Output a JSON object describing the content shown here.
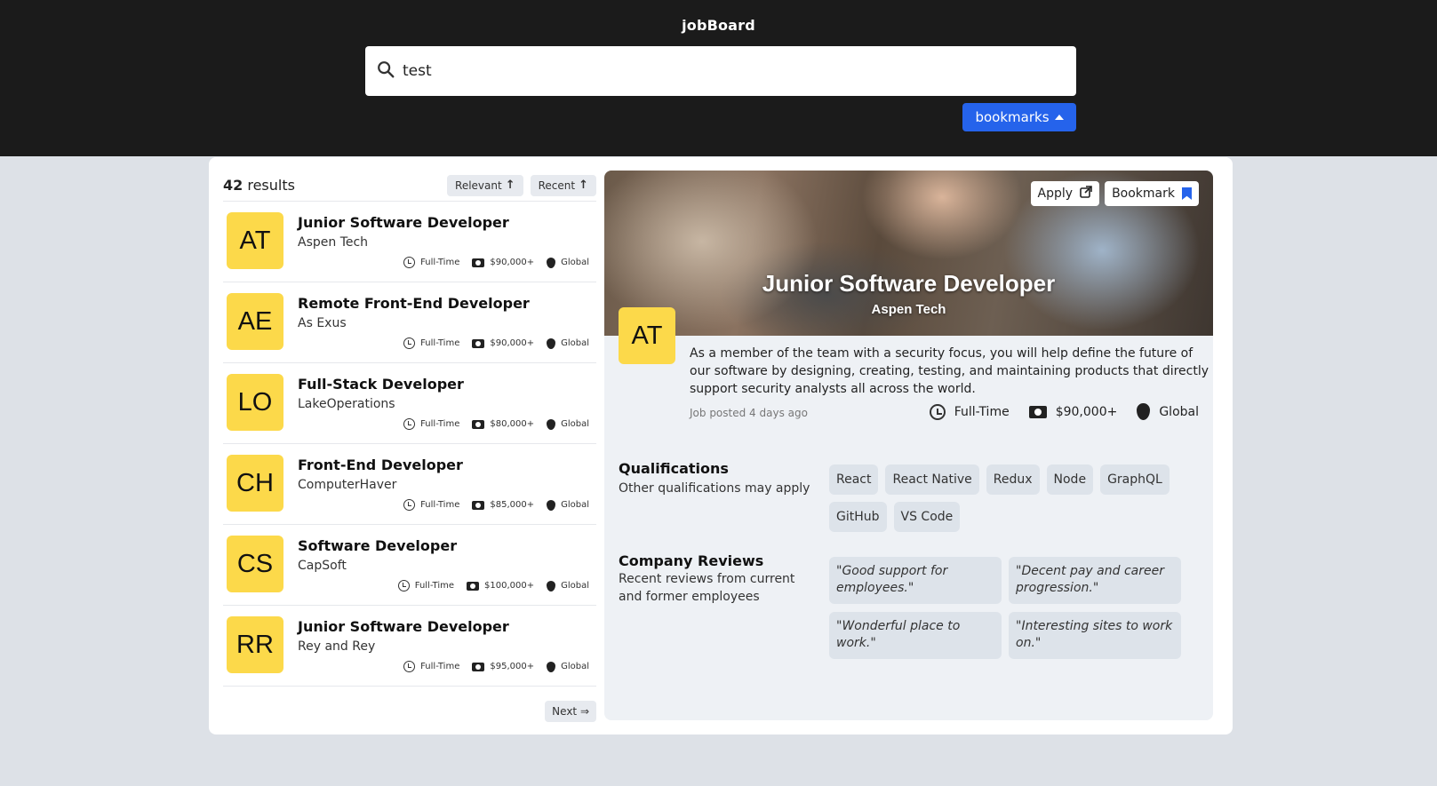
{
  "app": {
    "brand": "jobBoard"
  },
  "search": {
    "value": "test",
    "placeholder": ""
  },
  "header": {
    "bookmarks_label": "bookmarks"
  },
  "list": {
    "results_count": "42",
    "results_label": "results",
    "sort_relevant": "Relevant",
    "sort_recent": "Recent",
    "next_label": "Next ⇒",
    "jobs": [
      {
        "initials": "AT",
        "title": "Junior Software Developer",
        "company": "Aspen Tech",
        "type": "Full-Time",
        "salary": "$90,000+",
        "location": "Global"
      },
      {
        "initials": "AE",
        "title": "Remote Front-End Developer",
        "company": "As Exus",
        "type": "Full-Time",
        "salary": "$90,000+",
        "location": "Global"
      },
      {
        "initials": "LO",
        "title": "Full-Stack Developer",
        "company": "LakeOperations",
        "type": "Full-Time",
        "salary": "$80,000+",
        "location": "Global"
      },
      {
        "initials": "CH",
        "title": "Front-End Developer",
        "company": "ComputerHaver",
        "type": "Full-Time",
        "salary": "$85,000+",
        "location": "Global"
      },
      {
        "initials": "CS",
        "title": "Software Developer",
        "company": "CapSoft",
        "type": "Full-Time",
        "salary": "$100,000+",
        "location": "Global"
      },
      {
        "initials": "RR",
        "title": "Junior Software Developer",
        "company": "Rey and Rey",
        "type": "Full-Time",
        "salary": "$95,000+",
        "location": "Global"
      }
    ]
  },
  "detail": {
    "apply_label": "Apply",
    "bookmark_label": "Bookmark",
    "title": "Junior Software Developer",
    "company": "Aspen Tech",
    "initials": "AT",
    "description": "As a member of the team with a security focus, you will help define the future of our software by designing, creating, testing, and maintaining products that directly support security analysts all across the world.",
    "posted": "Job posted 4 days ago",
    "type": "Full-Time",
    "salary": "$90,000+",
    "location": "Global",
    "qualifications_title": "Qualifications",
    "qualifications_sub": "Other qualifications may apply",
    "tags": [
      "React",
      "React Native",
      "Redux",
      "Node",
      "GraphQL",
      "GitHub",
      "VS Code"
    ],
    "reviews_title": "Company Reviews",
    "reviews_sub": "Recent reviews from current and former employees",
    "reviews": [
      "\"Good support for employees.\"",
      "\"Decent pay and career progression.\"",
      "\"Wonderful place to work.\"",
      "\"Interesting sites to work on.\""
    ]
  },
  "colors": {
    "accent": "#2563eb",
    "logo_bg": "#fcd94a",
    "topbar": "#1b1b1b",
    "page_bg": "#dde1e7"
  },
  "icons": [
    "search-icon",
    "caret-up-icon",
    "arrow-up-icon",
    "clock-icon",
    "money-icon",
    "location-pin-icon",
    "external-link-icon",
    "bookmark-icon"
  ]
}
